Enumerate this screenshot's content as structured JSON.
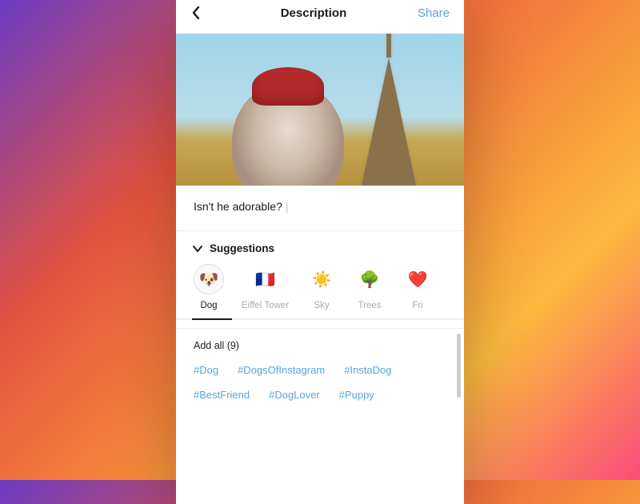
{
  "header": {
    "title": "Description",
    "share": "Share"
  },
  "caption": "Isn't he adorable?",
  "suggestions": {
    "label": "Suggestions",
    "categories": [
      {
        "emoji": "🐶",
        "label": "Dog",
        "active": true
      },
      {
        "emoji": "🇫🇷",
        "label": "Eiffel Tower"
      },
      {
        "emoji": "☀️",
        "label": "Sky"
      },
      {
        "emoji": "🌳",
        "label": "Trees"
      },
      {
        "emoji": "❤️",
        "label": "Fri"
      }
    ]
  },
  "tags": {
    "addall": "Add all (9)",
    "items": [
      "#Dog",
      "#DogsOfInstagram",
      "#InstaDog",
      "#BestFriend",
      "#DogLover",
      "#Puppy"
    ]
  }
}
